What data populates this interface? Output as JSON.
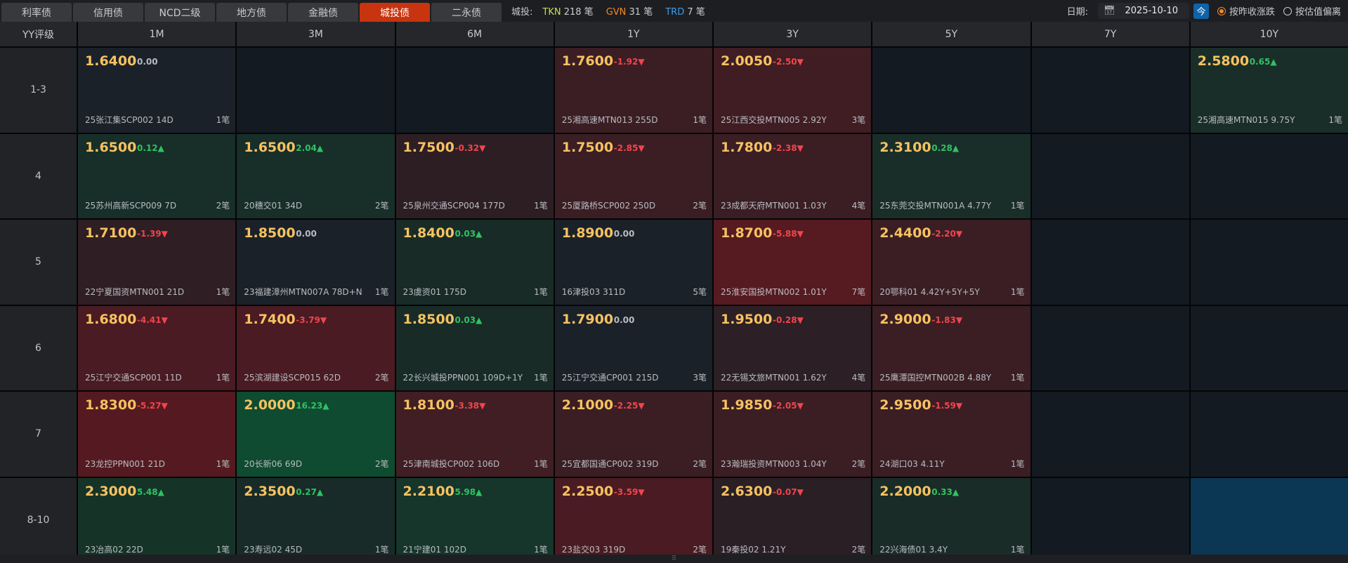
{
  "tabs": [
    {
      "label": "利率债"
    },
    {
      "label": "信用债"
    },
    {
      "label": "NCD二级"
    },
    {
      "label": "地方债"
    },
    {
      "label": "金融债"
    },
    {
      "label": "城投债",
      "active": true
    },
    {
      "label": "二永债"
    }
  ],
  "summary": {
    "label": "城投:",
    "items": [
      {
        "code": "TKN",
        "count": "218 笔",
        "color": "#c5e04a"
      },
      {
        "code": "GVN",
        "count": "31 笔",
        "color": "#f08a28"
      },
      {
        "code": "TRD",
        "count": "7 笔",
        "color": "#3d9be9"
      }
    ]
  },
  "controls": {
    "date_label": "日期:",
    "date_value": "2025-10-10",
    "today_label": "今",
    "radio1": "按昨收涨跌",
    "radio2": "按估值偏离"
  },
  "colors": {
    "up": "#2fc262",
    "down": "#f0454d",
    "flat": "#b8bcc2"
  },
  "header": {
    "corner": "YY评级",
    "columns": [
      "1M",
      "3M",
      "6M",
      "1Y",
      "3Y",
      "5Y",
      "7Y",
      "10Y"
    ]
  },
  "rows": [
    {
      "label": "1-3",
      "cells": [
        {
          "yield": "1.6400",
          "change": "0.00",
          "dir": "flat",
          "bond": "25张江集SCP002 14D",
          "count": "1笔",
          "bg": "#1b2129"
        },
        null,
        null,
        {
          "yield": "1.7600",
          "change": "-1.92▼",
          "dir": "down",
          "bond": "25湘高速MTN013 255D",
          "count": "1笔",
          "bg": "#3a1e24"
        },
        {
          "yield": "2.0050",
          "change": "-2.50▼",
          "dir": "down",
          "bond": "25江西交投MTN005 2.92Y",
          "count": "3笔",
          "bg": "#3f1d23"
        },
        null,
        null,
        {
          "yield": "2.5800",
          "change": "0.65▲",
          "dir": "up",
          "bond": "25湘高速MTN015 9.75Y",
          "count": "1笔",
          "bg": "#1a2e29"
        }
      ]
    },
    {
      "label": "4",
      "cells": [
        {
          "yield": "1.6500",
          "change": "0.12▲",
          "dir": "up",
          "bond": "25苏州高新SCP009 7D",
          "count": "2笔",
          "bg": "#172e29"
        },
        {
          "yield": "1.6500",
          "change": "2.04▲",
          "dir": "up",
          "bond": "20穗交01 34D",
          "count": "2笔",
          "bg": "#172e29"
        },
        {
          "yield": "1.7500",
          "change": "-0.32▼",
          "dir": "down",
          "bond": "25泉州交通SCP004 177D",
          "count": "1笔",
          "bg": "#2d1e24"
        },
        {
          "yield": "1.7500",
          "change": "-2.85▼",
          "dir": "down",
          "bond": "25厦路桥SCP002 250D",
          "count": "2笔",
          "bg": "#3a1e24"
        },
        {
          "yield": "1.7800",
          "change": "-2.38▼",
          "dir": "down",
          "bond": "23成都天府MTN001 1.03Y",
          "count": "4笔",
          "bg": "#3a1e24"
        },
        {
          "yield": "2.3100",
          "change": "0.28▲",
          "dir": "up",
          "bond": "25东莞交投MTN001A 4.77Y",
          "count": "1笔",
          "bg": "#1a2e29"
        },
        null,
        null
      ]
    },
    {
      "label": "5",
      "cells": [
        {
          "yield": "1.7100",
          "change": "-1.39▼",
          "dir": "down",
          "bond": "22宁夏国资MTN001 21D",
          "count": "1笔",
          "bg": "#2f1e24"
        },
        {
          "yield": "1.8500",
          "change": "0.00",
          "dir": "flat",
          "bond": "23福建漳州MTN007A 78D+N",
          "count": "1笔",
          "bg": "#1b2129"
        },
        {
          "yield": "1.8400",
          "change": "0.03▲",
          "dir": "up",
          "bond": "23虞资01 175D",
          "count": "1笔",
          "bg": "#182b27"
        },
        {
          "yield": "1.8900",
          "change": "0.00",
          "dir": "flat",
          "bond": "16津投03 311D",
          "count": "5笔",
          "bg": "#1b2129"
        },
        {
          "yield": "1.8700",
          "change": "-5.88▼",
          "dir": "down",
          "bond": "25淮安国投MTN002 1.01Y",
          "count": "7笔",
          "bg": "#561a21"
        },
        {
          "yield": "2.4400",
          "change": "-2.20▼",
          "dir": "down",
          "bond": "20鄂科01 4.42Y+5Y+5Y",
          "count": "1笔",
          "bg": "#3a1e24"
        },
        null,
        null
      ]
    },
    {
      "label": "6",
      "cells": [
        {
          "yield": "1.6800",
          "change": "-4.41▼",
          "dir": "down",
          "bond": "25江宁交通SCP001 11D",
          "count": "1笔",
          "bg": "#4a1b22"
        },
        {
          "yield": "1.7400",
          "change": "-3.79▼",
          "dir": "down",
          "bond": "25滨湖建设SCP015 62D",
          "count": "2笔",
          "bg": "#4a1b22"
        },
        {
          "yield": "1.8500",
          "change": "0.03▲",
          "dir": "up",
          "bond": "22长兴城投PPN001 109D+1Y",
          "count": "1笔",
          "bg": "#182b27"
        },
        {
          "yield": "1.7900",
          "change": "0.00",
          "dir": "flat",
          "bond": "25江宁交通CP001 215D",
          "count": "3笔",
          "bg": "#1b2129"
        },
        {
          "yield": "1.9500",
          "change": "-0.28▼",
          "dir": "down",
          "bond": "22无锡文旅MTN001 1.62Y",
          "count": "4笔",
          "bg": "#2c1f25"
        },
        {
          "yield": "2.9000",
          "change": "-1.83▼",
          "dir": "down",
          "bond": "25鹰潭国控MTN002B 4.88Y",
          "count": "1笔",
          "bg": "#3a1e24"
        },
        null,
        null
      ]
    },
    {
      "label": "7",
      "cells": [
        {
          "yield": "1.8300",
          "change": "-5.27▼",
          "dir": "down",
          "bond": "23龙控PPN001 21D",
          "count": "1笔",
          "bg": "#551a21"
        },
        {
          "yield": "2.0000",
          "change": "16.23▲",
          "dir": "up",
          "bond": "20长新06 69D",
          "count": "2笔",
          "bg": "#0f4b30"
        },
        {
          "yield": "1.8100",
          "change": "-3.38▼",
          "dir": "down",
          "bond": "25津南城投CP002 106D",
          "count": "1笔",
          "bg": "#401e24"
        },
        {
          "yield": "2.1000",
          "change": "-2.25▼",
          "dir": "down",
          "bond": "25宜都国通CP002 319D",
          "count": "2笔",
          "bg": "#3a1e24"
        },
        {
          "yield": "1.9850",
          "change": "-2.05▼",
          "dir": "down",
          "bond": "23瀚瑞投资MTN003 1.04Y",
          "count": "2笔",
          "bg": "#3a1e24"
        },
        {
          "yield": "2.9500",
          "change": "-1.59▼",
          "dir": "down",
          "bond": "24湖口03 4.11Y",
          "count": "1笔",
          "bg": "#3a1e24"
        },
        null,
        null
      ]
    },
    {
      "label": "8-10",
      "cells": [
        {
          "yield": "2.3000",
          "change": "5.48▲",
          "dir": "up",
          "bond": "23冶高02 22D",
          "count": "1笔",
          "bg": "#163328"
        },
        {
          "yield": "2.3500",
          "change": "0.27▲",
          "dir": "up",
          "bond": "23寿远02 45D",
          "count": "1笔",
          "bg": "#182b28"
        },
        {
          "yield": "2.2100",
          "change": "5.98▲",
          "dir": "up",
          "bond": "21宁建01 102D",
          "count": "1笔",
          "bg": "#16352b"
        },
        {
          "yield": "2.2500",
          "change": "-3.59▼",
          "dir": "down",
          "bond": "23盐交03 319D",
          "count": "2笔",
          "bg": "#4a1b22"
        },
        {
          "yield": "2.6300",
          "change": "-0.07▼",
          "dir": "down",
          "bond": "19秦投02 1.21Y",
          "count": "2笔",
          "bg": "#2a1f25"
        },
        {
          "yield": "2.2000",
          "change": "0.33▲",
          "dir": "up",
          "bond": "22兴海债01 3.4Y",
          "count": "1笔",
          "bg": "#1a2c28"
        },
        null,
        {
          "selected": true,
          "bg": "#0b3654"
        }
      ]
    }
  ]
}
